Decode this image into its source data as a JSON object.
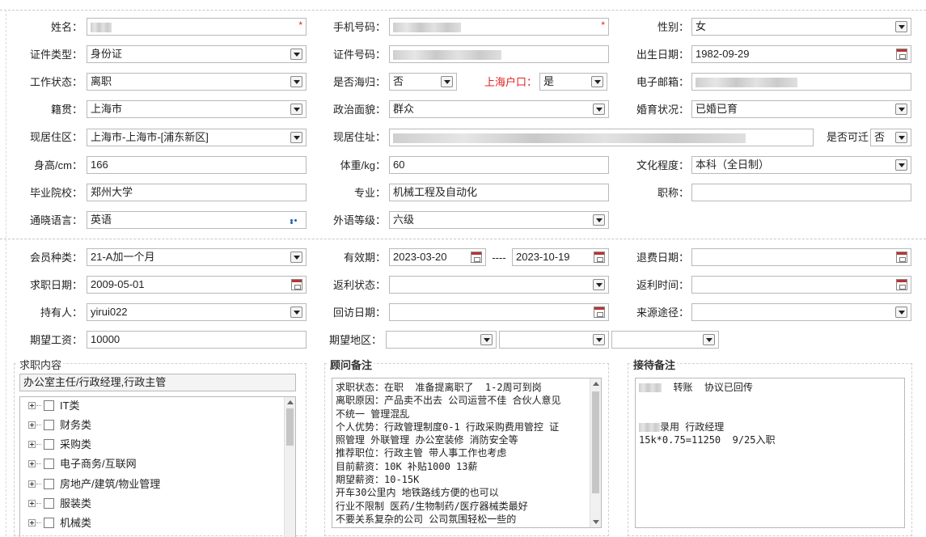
{
  "required_mark": "*",
  "basic": {
    "name_label": "姓名：",
    "phone_label": "手机号码：",
    "gender_label": "性别：",
    "gender_value": "女",
    "id_type_label": "证件类型：",
    "id_type_value": "身份证",
    "id_no_label": "证件号码：",
    "birth_label": "出生日期：",
    "birth_value": "1982-09-29",
    "work_status_label": "工作状态：",
    "work_status_value": "离职",
    "overseas_label": "是否海归：",
    "overseas_value": "否",
    "sh_hukou_label": "上海户口：",
    "sh_hukou_value": "是",
    "email_label": "电子邮箱：",
    "native_label": "籍贯：",
    "native_value": "上海市",
    "political_label": "政治面貌：",
    "political_value": "群众",
    "marital_label": "婚育状况：",
    "marital_value": "已婚已育",
    "district_label": "现居住区：",
    "district_value": "上海市-上海市-[浦东新区]",
    "address_label": "现居住址：",
    "relocate_label": "是否可迁",
    "relocate_value": "否",
    "height_label": "身高/cm：",
    "height_value": "166",
    "weight_label": "体重/kg：",
    "weight_value": "60",
    "education_label": "文化程度：",
    "education_value": "本科（全日制）",
    "school_label": "毕业院校：",
    "school_value": "郑州大学",
    "major_label": "专业：",
    "major_value": "机械工程及自动化",
    "title_label": "职称：",
    "title_value": "",
    "language_label": "通晓语言：",
    "language_value": "英语",
    "lang_level_label": "外语等级：",
    "lang_level_value": "六级"
  },
  "member": {
    "type_label": "会员种类：",
    "type_value": "21-A加一个月",
    "valid_label": "有效期：",
    "valid_from": "2023-03-20",
    "valid_sep": "----",
    "valid_to": "2023-10-19",
    "refund_date_label": "退费日期：",
    "refund_date_value": "",
    "job_date_label": "求职日期：",
    "job_date_value": "2009-05-01",
    "rebate_status_label": "返利状态：",
    "rebate_status_value": "",
    "rebate_time_label": "返利时间：",
    "rebate_time_value": "",
    "holder_label": "持有人：",
    "holder_value": "yirui022",
    "revisit_label": "回访日期：",
    "revisit_value": "",
    "source_label": "来源途径：",
    "source_value": "",
    "salary_label": "期望工资：",
    "salary_value": "10000",
    "region_label": "期望地区："
  },
  "job_content": {
    "title": "求职内容",
    "selected": "办公室主任/行政经理,行政主管",
    "tree": [
      "IT类",
      "财务类",
      "采购类",
      "电子商务/互联网",
      "房地产/建筑/物业管理",
      "服装类",
      "机械类"
    ]
  },
  "consultant": {
    "title": "顾问备注",
    "lines": [
      "求职状态：在职  准备提离职了  1-2周可到岗",
      "离职原因：产品卖不出去 公司运营不佳 合伙人意见",
      "不统一 管理混乱",
      "个人优势：行政管理制度0-1 行政采购费用管控 证",
      "照管理 外联管理 办公室装修 消防安全等",
      "推荐职位：行政主管 带人事工作也考虑",
      "目前薪资：10K 补贴1000 13薪",
      "期望薪资：10-15K",
      "开车30公里内 地铁路线方便的也可以",
      "行业不限制 医药/生物制药/医疗器械类最好",
      "不要关系复杂的公司 公司氛围轻松一些的"
    ]
  },
  "reception": {
    "title": "接待备注",
    "line1": "  转账  协议已回传",
    "line2": "录用 行政经理",
    "line3": "15k*0.75=11250  9/25入职"
  },
  "icons": {
    "dropdown": "chevron-down-icon",
    "calendar": "calendar-icon",
    "more": "more-icon",
    "tree_expand": "plus-icon",
    "checkbox": "checkbox-icon"
  },
  "colors": {
    "highlight_label": "#e02020",
    "link_blue": "#1f5fa8"
  }
}
